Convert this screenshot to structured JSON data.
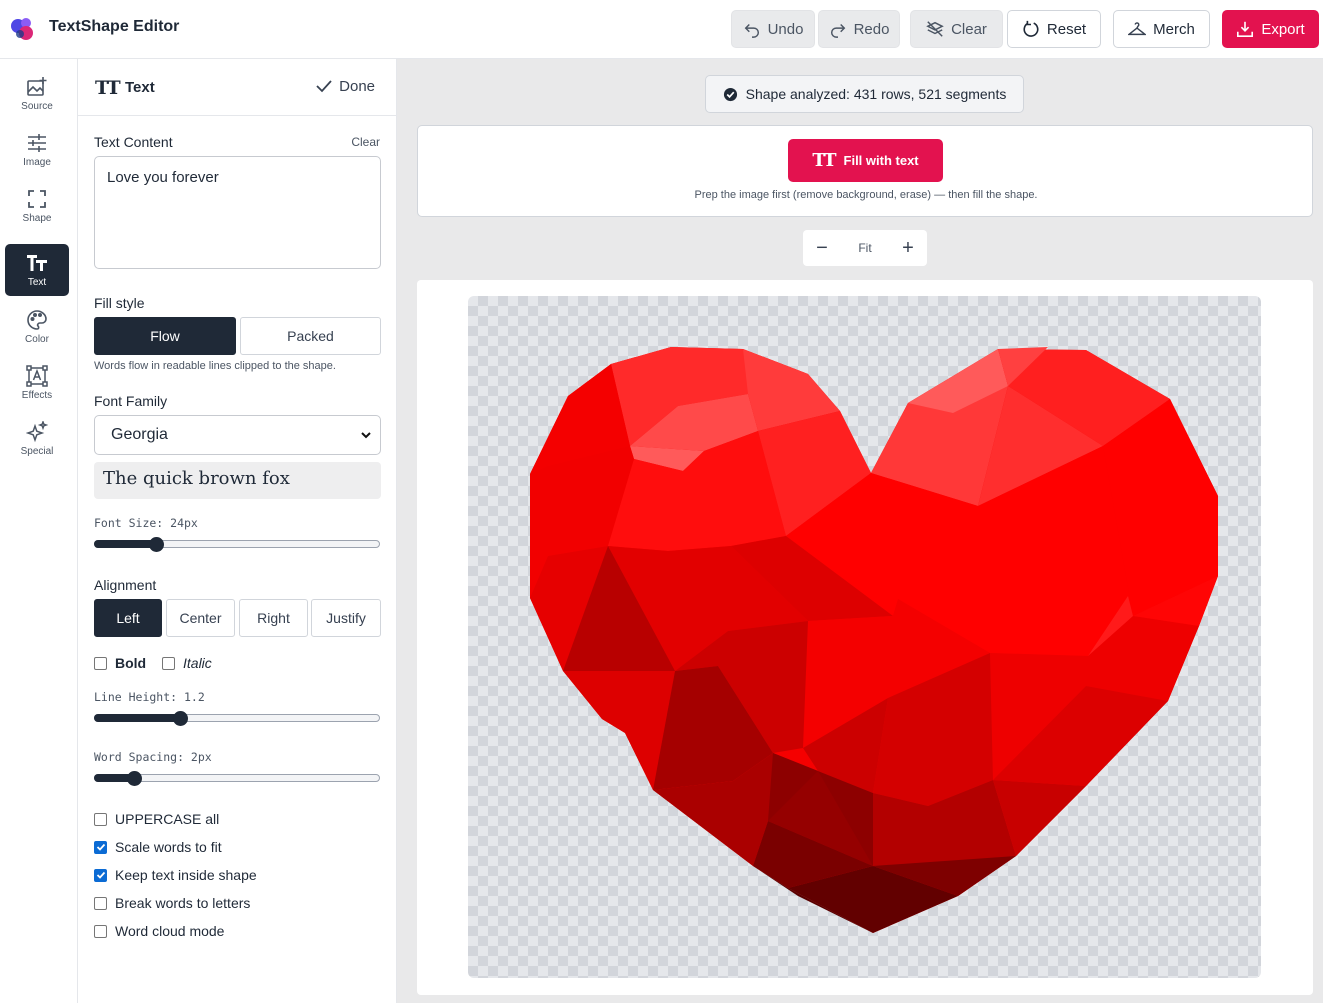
{
  "app": {
    "title": "TextShape Editor"
  },
  "toolbar": {
    "undo": "Undo",
    "redo": "Redo",
    "clear": "Clear",
    "reset": "Reset",
    "merch": "Merch",
    "export": "Export"
  },
  "rail": {
    "items": [
      {
        "label": "Source",
        "icon": "image-add-icon"
      },
      {
        "label": "Image",
        "icon": "sliders-icon"
      },
      {
        "label": "Shape",
        "icon": "frame-corners-icon"
      },
      {
        "label": "Text",
        "icon": "text-tt-icon",
        "active": true
      },
      {
        "label": "Color",
        "icon": "palette-icon"
      },
      {
        "label": "Effects",
        "icon": "text-box-icon"
      },
      {
        "label": "Special",
        "icon": "sparkles-icon"
      }
    ]
  },
  "panel": {
    "icon_text": "TT",
    "title": "Text",
    "done_label": "Done",
    "text_content_label": "Text Content",
    "clear_label": "Clear",
    "text_value": "Love you forever",
    "fill_style_label": "Fill style",
    "fill_options": [
      "Flow",
      "Packed"
    ],
    "fill_selected": "Flow",
    "fill_help": "Words flow in readable lines clipped to the shape.",
    "font_family_label": "Font Family",
    "font_family_value": "Georgia",
    "font_preview": "The quick brown fox",
    "font_size_label": "Font Size: 24px",
    "font_size_fraction": 0.2,
    "alignment_label": "Alignment",
    "alignment_options": [
      "Left",
      "Center",
      "Right",
      "Justify"
    ],
    "alignment_selected": "Left",
    "bold_label": "Bold",
    "italic_label": "Italic",
    "bold_checked": false,
    "italic_checked": false,
    "line_height_label": "Line Height: 1.2",
    "line_height_fraction": 0.29,
    "word_spacing_label": "Word Spacing: 2px",
    "word_spacing_fraction": 0.12,
    "options": [
      {
        "label": "UPPERCASE all",
        "checked": false
      },
      {
        "label": "Scale words to fit",
        "checked": true
      },
      {
        "label": "Keep text inside shape",
        "checked": true
      },
      {
        "label": "Break words to letters",
        "checked": false
      },
      {
        "label": "Word cloud mode",
        "checked": false
      }
    ]
  },
  "main": {
    "status": "Shape analyzed: 431 rows, 521 segments",
    "fill_button": "Fill with text",
    "fill_button_icon": "TT",
    "fill_hint": "Prep the image first (remove background, erase) — then fill the shape.",
    "zoom_fit": "Fit",
    "zoom_minus": "−",
    "zoom_plus": "+"
  },
  "colors": {
    "accent": "#e3124f",
    "dark": "#1f2937",
    "heart_red": "#ff0000"
  }
}
